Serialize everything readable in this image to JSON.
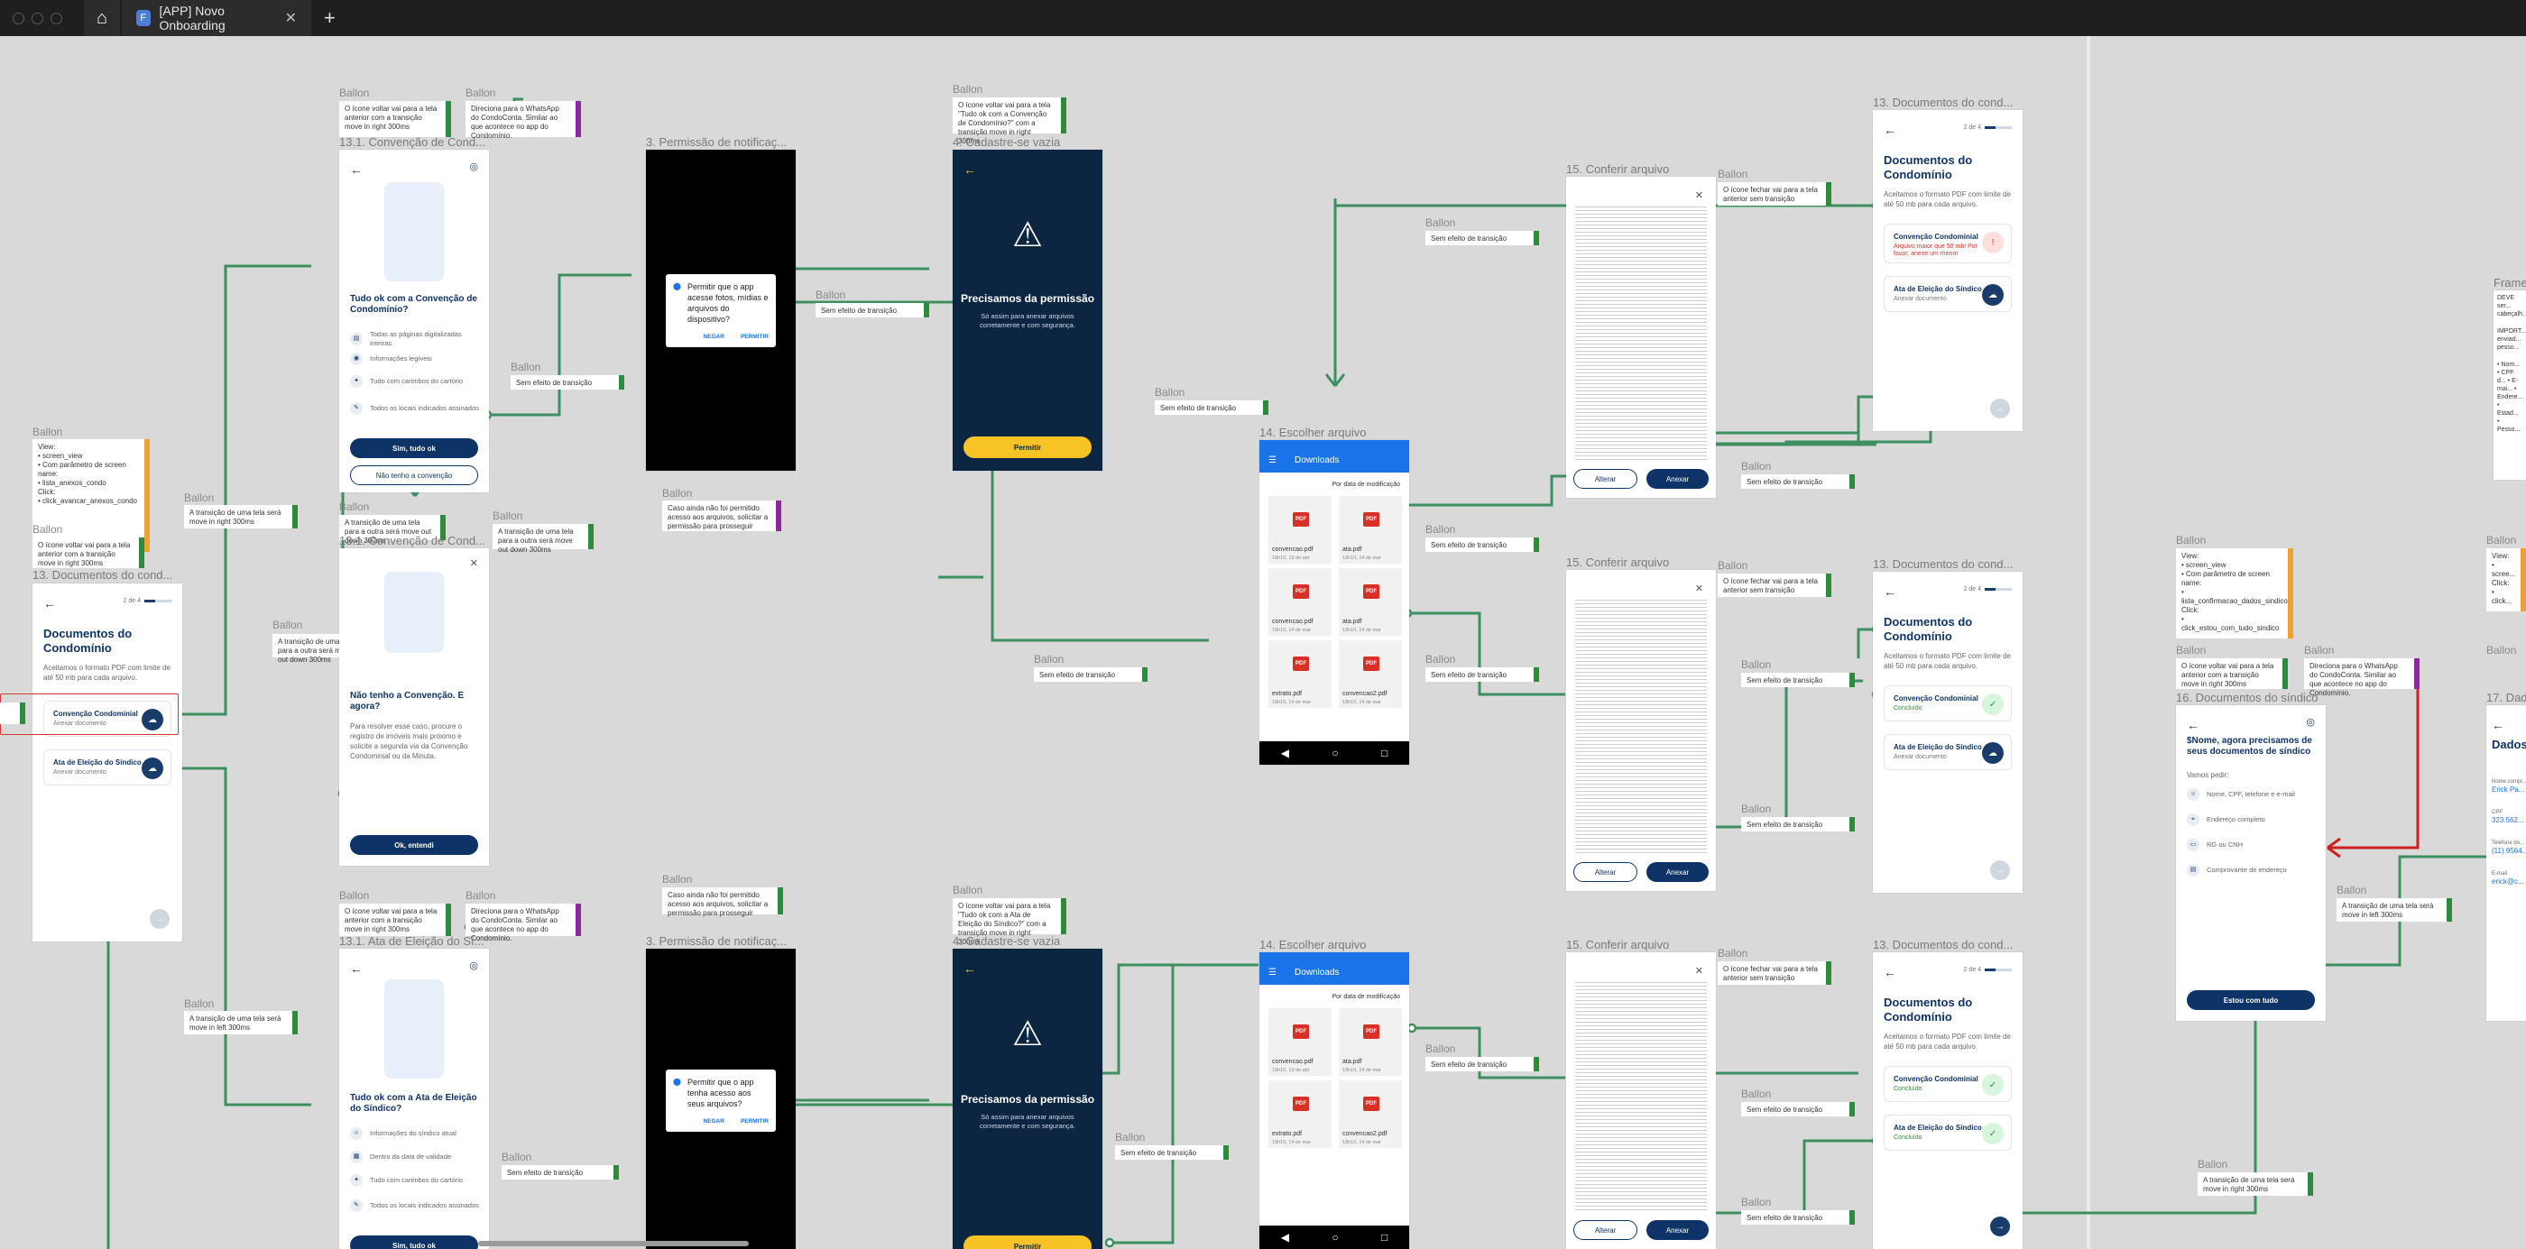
{
  "window": {
    "tab_title": "[APP] Novo Onboarding"
  },
  "frames": {
    "f1": "13.1. Convenção de Cond...",
    "f2": "13.1. Convenção de Cond...",
    "f3": "13. Documentos do cond...",
    "f4": "13.1. Ata de Eleição do Sí...",
    "f5": "3. Permissão de notificaç...",
    "f6": "4. Cadastre-se vazia",
    "f7": "3. Permissão de notificaç...",
    "f8": "4. Cadastre-se vazia",
    "f9": "14. Escolher arquivo",
    "f10": "14. Escolher arquivo",
    "f11": "15. Conferir arquivo",
    "f12": "15. Conferir arquivo",
    "f13": "15. Conferir arquivo",
    "f14": "13. Documentos do cond...",
    "f15": "13. Documentos do cond...",
    "f16": "13. Documentos do cond...",
    "f17": "16. Documentos do síndico",
    "f18": "17. Dado..."
  },
  "balloon": "Ballon",
  "notes": {
    "n_view": "View:\n• screen_view\n  • Com parâmetro de screen name:\n    • lista_anexos_condo\nClick:\n• click_avancar_anexos_condo",
    "n_back": "O ícone voltar vai para a tela anterior com a transição move in right 300ms",
    "n_wpp": "Direciona para o WhatsApp do CondoConta. Similar ao que acontece no app do Condomínio.",
    "n_move_right": "A transição de uma tela será move in right 300ms",
    "n_move_left": "A transição de uma tela será move in left 300ms",
    "n_outra_down": "A transição de uma tela para a outra será move out down 300ms",
    "n_outra_down2": "A transição de uma tela para a outra será move out down 300ms",
    "n_sem": "Sem efeito de transição",
    "n_perm": "Caso ainda não foi permitido acesso aos arquivos, solicitar a permissão para prosseguir",
    "n_tudo_ok": "O ícone voltar vai para a tela \"Tudo ok com a Convenção de Condomínio?\" com a transição move in right 300ms",
    "n_tudo_ok_ata": "O ícone voltar vai para a tela \"Tudo ok com a Ata de Eleição do Síndico?\" com a transição move in right 300ms",
    "n_fechar": "O ícone fechar vai para a tela anterior sem transição",
    "n_view2": "View:\n• screen_view\n  • Com parâmetro de screen name:\n    • lista_confirmacao_dados_sindico\nClick:\n• click_estou_com_tudo_sindico",
    "n_view3": "View:\n• scree...\nClick:\n• click..."
  },
  "docs": {
    "title": "Documentos do Condomínio",
    "intro": "Aceitamos o formato PDF com limite de até 50 mb para cada arquivo.",
    "step": "2 de 4",
    "conv": "Convenção Condominial",
    "ata": "Ata de Eleição do Síndico",
    "anexar": "Anexar documento",
    "concluido": "Concluído",
    "erro": "Arquivo maior que 50 mb! Por favor, anexe um menor"
  },
  "conv_screen": {
    "title": "Tudo ok com a Convenção de Condomínio?",
    "items": [
      "Todas as páginas digitalizadas inteiras",
      "Informações legíveis",
      "Tudo com carimbos do cartório",
      "Todos os locais indicados assinados"
    ],
    "yes": "Sim, tudo ok",
    "no": "Não tenho a convenção"
  },
  "no_conv": {
    "title": "Não tenho a Convenção. E agora?",
    "body": "Para resolver esse caso, procure o registro de imóveis mais próximo e solicite a segunda via da Convenção Condominial ou da Minuta.",
    "ok": "Ok, entendi"
  },
  "ata_screen": {
    "title": "Tudo ok com a Ata de Eleição do Síndico?",
    "items": [
      "Informações do síndico atual",
      "Dentro da data de validade",
      "Tudo com carimbos do cartório",
      "Todos os locais indicados assinados"
    ],
    "yes": "Sim, tudo ok"
  },
  "perm_dialog": {
    "text": "Permitir que o app acesse fotos, mídias e arquivos do dispositivo?",
    "text2": "Permitir que o app tenha acesso aos seus arquivos?",
    "deny": "NEGAR",
    "allow": "PERMITIR"
  },
  "perm_screen": {
    "title": "Precisamos da permissão",
    "sub": "Só assim para anexar arquivos corretamente e com segurança.",
    "btn": "Permitir"
  },
  "downloads": {
    "title": "Downloads",
    "sort": "Por data de modificação",
    "files": [
      {
        "name": "convencao.pdf",
        "date": "19h10, 13 de abr"
      },
      {
        "name": "ata.pdf",
        "date": "19h10, 14 de mar"
      },
      {
        "name": "convencao.pdf",
        "date": "19h10, 14 de mar"
      },
      {
        "name": "ata.pdf",
        "date": "19h10, 14 de mar"
      },
      {
        "name": "extrato.pdf",
        "date": "19h10, 14 de mar"
      },
      {
        "name": "convencao2.pdf",
        "date": "19h10, 14 de mar"
      }
    ]
  },
  "review": {
    "alterar": "Alterar",
    "anexar": "Anexar"
  },
  "sindico": {
    "title": "$Nome, agora precisamos de seus documentos de síndico",
    "vamos": "Vamos pedir:",
    "items": [
      "Nome, CPF, telefone e e-mail",
      "Endereço completo",
      "RG ou CNH",
      "Comprovante de endereço"
    ],
    "btn": "Estou com tudo"
  },
  "dados": {
    "title": "Dados",
    "nome_lbl": "Nome compl...",
    "nome": "Erick Pa...",
    "cpf_lbl": "CPF",
    "cpf": "323.562...",
    "tel_lbl": "Telefone do...",
    "tel": "(11) 9564...",
    "email_lbl": "E-mail",
    "email": "erick@c..."
  },
  "right_fragments": {
    "a": "Frame",
    "b": "DEVE ser... cabeçalh...",
    "c": "IMPORT... enviad... pesso...",
    "d": "• Nom... • CPF d... • E-mai... • Endere... • Estad... • Pesso..."
  },
  "colors": {
    "connector": "#3d8f5e",
    "connector_red": "#cc1f1f",
    "brand": "#0e3366"
  }
}
